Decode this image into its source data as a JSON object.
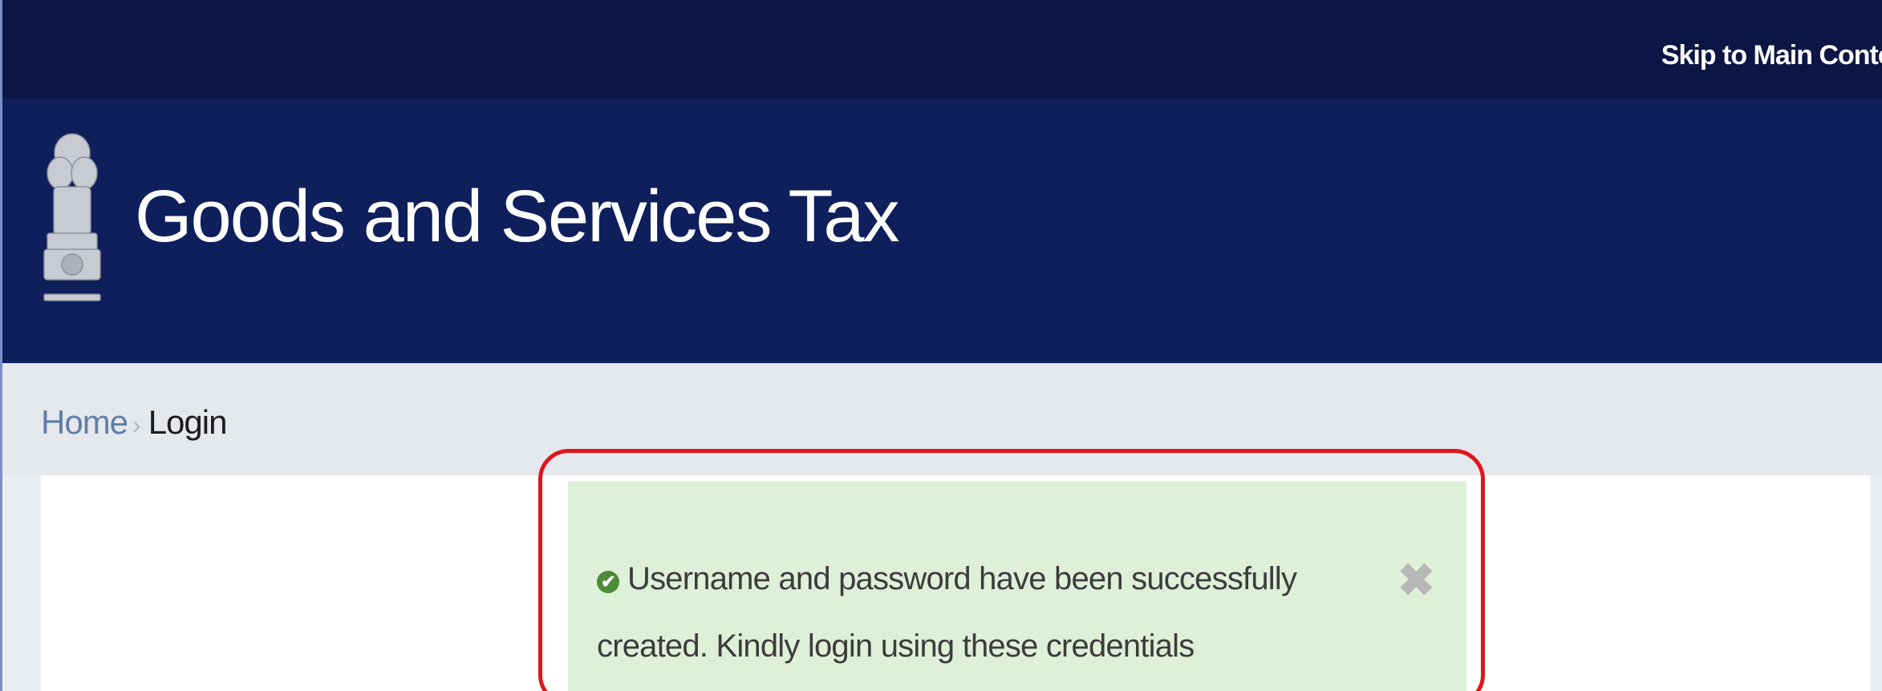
{
  "topbar": {
    "skip_link": "Skip to Main Conter"
  },
  "header": {
    "emblem_icon": "national-emblem-icon",
    "title": "Goods and Services Tax"
  },
  "breadcrumb": {
    "home": "Home",
    "separator": "›",
    "current": "Login"
  },
  "alert": {
    "icon": "check-circle-icon",
    "icon_glyph": "✔",
    "message": "Username and password have been successfully created. Kindly login using these credentials",
    "close_icon": "close-icon",
    "close_glyph": "✖"
  },
  "colors": {
    "topbar_bg": "#0b1645",
    "header_bg": "#0f1f5c",
    "alert_bg": "#dff0d8",
    "highlight": "#e0161b"
  }
}
